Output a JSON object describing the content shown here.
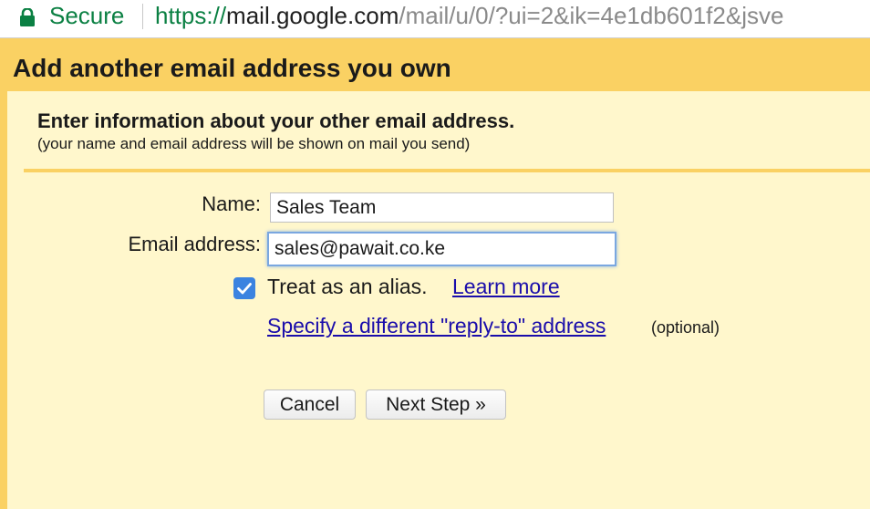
{
  "browser": {
    "secure_label": "Secure",
    "url_protocol": "https://",
    "url_host": "mail.google.com",
    "url_path": "/mail/u/0/?ui=2&ik=4e1db601f2&jsve",
    "secure_color": "#0b8043"
  },
  "dialog": {
    "title": "Add another email address you own",
    "heading": "Enter information about your other email address.",
    "subheading": "(your name and email address will be shown on mail you send)",
    "name_label": "Name:",
    "name_value": "Sales Team",
    "email_label": "Email address:",
    "email_value": "sales@pawait.co.ke",
    "alias_checked": true,
    "alias_label": "Treat as an alias.",
    "learn_more_label": "Learn more",
    "reply_to_label": "Specify a different \"reply-to\" address",
    "optional_label": "(optional)",
    "cancel_label": "Cancel",
    "next_label": "Next Step »"
  },
  "colors": {
    "accent": "#fad163",
    "panel": "#fff7cc",
    "checkbox": "#3b83e0",
    "link": "#1a0dab"
  },
  "icons": {
    "lock": "lock-icon",
    "check": "checkmark-icon"
  }
}
